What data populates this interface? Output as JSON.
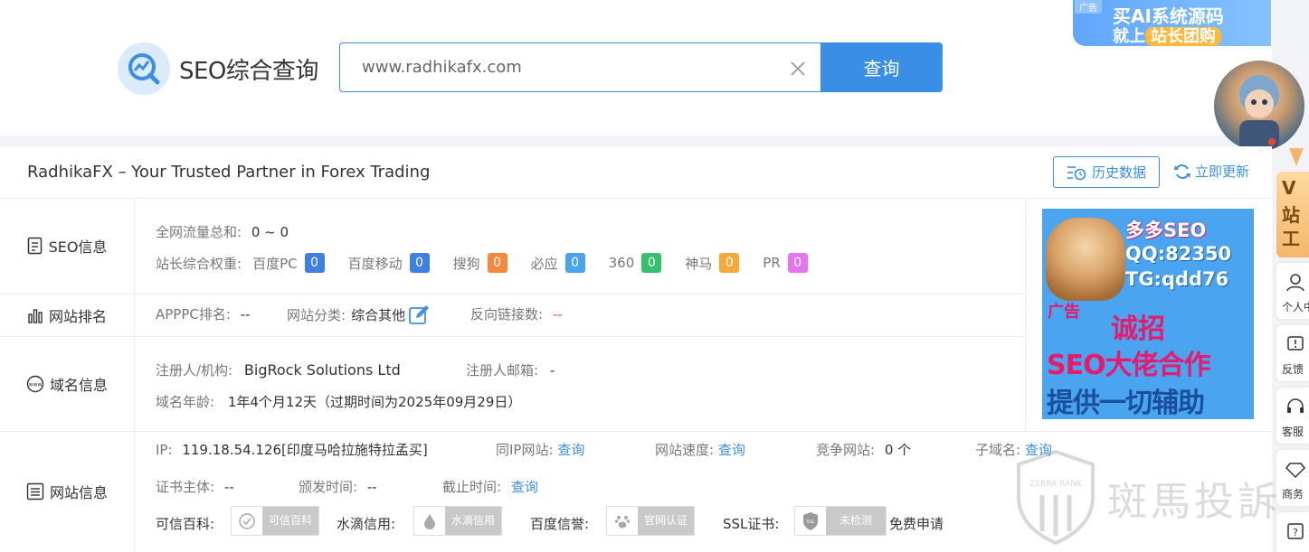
{
  "header": {
    "logo_title": "SEO综合查询",
    "search_value": "www.radhikafx.com",
    "search_button": "查询"
  },
  "top_ad": {
    "tag": "广告",
    "line1": "买AI系统源码",
    "line2_prefix": "就上",
    "line2_highlight": "站长团购"
  },
  "card": {
    "title": "RadhikaFX – Your Trusted Partner in Forex Trading",
    "history_button": "历史数据",
    "refresh_link": "立即更新"
  },
  "seo": {
    "label": "SEO信息",
    "traffic_label": "全网流量总和:",
    "traffic_value": "0 ~ 0",
    "weight_label": "站长综合权重:",
    "weights": [
      {
        "name": "百度PC",
        "value": "0",
        "color": "#3d7fe3"
      },
      {
        "name": "百度移动",
        "value": "0",
        "color": "#3d7fe3"
      },
      {
        "name": "搜狗",
        "value": "0",
        "color": "#f5893b"
      },
      {
        "name": "必应",
        "value": "0",
        "color": "#4aa3ef"
      },
      {
        "name": "360",
        "value": "0",
        "color": "#36c06b"
      },
      {
        "name": "神马",
        "value": "0",
        "color": "#f5a93b"
      },
      {
        "name": "PR",
        "value": "0",
        "color": "#e476f0"
      }
    ]
  },
  "rank": {
    "label": "网站排名",
    "apppc_label": "APPPC排名:",
    "apppc_value": "--",
    "category_label": "网站分类:",
    "category_value": "综合其他",
    "backlinks_label": "反向链接数:",
    "backlinks_value": "--"
  },
  "domain": {
    "label": "域名信息",
    "registrant_label": "注册人/机构:",
    "registrant_value": "BigRock Solutions Ltd",
    "email_label": "注册人邮箱:",
    "email_value": "-",
    "age_label": "域名年龄:",
    "age_value": "1年4个月12天（过期时间为2025年09月29日）"
  },
  "site": {
    "label": "网站信息",
    "ip_label": "IP:",
    "ip_value": "119.18.54.126[印度马哈拉施特拉孟买]",
    "same_ip_label": "同IP网站:",
    "same_ip_link": "查询",
    "speed_label": "网站速度:",
    "speed_link": "查询",
    "competitor_label": "竞争网站:",
    "competitor_value": "0 个",
    "subdomain_label": "子域名:",
    "subdomain_link": "查询",
    "cert_subject_label": "证书主体:",
    "cert_subject_value": "--",
    "issue_label": "颁发时间:",
    "issue_value": "--",
    "expire_label": "截止时间:",
    "expire_link": "查询",
    "kexin_label": "可信百科:",
    "kexin_badge": "可信百科",
    "shuidi_label": "水滴信用:",
    "shuidi_badge": "水滴信用",
    "baidu_label": "百度信誉:",
    "baidu_badge": "官网认证",
    "ssl_label": "SSL证书:",
    "ssl_badge": "未检测",
    "ssl_apply": "免费申请"
  },
  "side_ad": {
    "line1": "多多SEO",
    "line2": "QQ:82350",
    "line3": "TG:qdd76",
    "tag": "广告",
    "line4": "诚招",
    "line5": "SEO大佬合作",
    "line6": "提供一切辅助"
  },
  "right_rail": {
    "vip_text1": "V",
    "vip_text2": "站",
    "vip_text3": "工",
    "items": [
      "个人中",
      "反馈",
      "客服",
      "商务",
      ""
    ]
  },
  "watermark": {
    "text": "斑馬投訴",
    "shield_text": "ZEBRA RANK"
  }
}
